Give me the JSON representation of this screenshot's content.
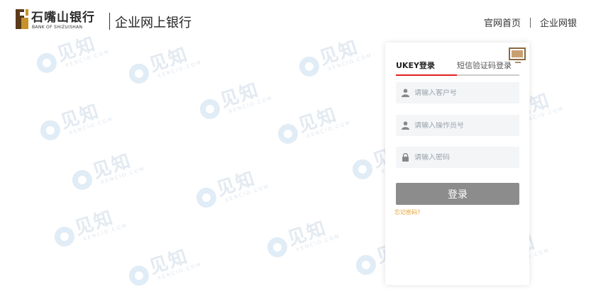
{
  "header": {
    "bank_name_cn": "石嘴山银行",
    "bank_name_en": "BANK OF SHIZUISHAN",
    "site_title": "企业网上银行",
    "nav": [
      "官网首页",
      "企业网银"
    ]
  },
  "login": {
    "tabs": [
      {
        "label": "UKEY登录",
        "active": true
      },
      {
        "label": "短信验证码登录",
        "active": false
      }
    ],
    "customer_no": {
      "placeholder": "请输入客户号",
      "value": ""
    },
    "operator_no": {
      "placeholder": "请输入操作员号",
      "value": ""
    },
    "password": {
      "placeholder": "请输入密码",
      "value": ""
    },
    "submit_label": "登录",
    "forgot_label": "忘记密码?"
  },
  "watermark": {
    "text": "见知",
    "sub": "XENCIO.COM"
  },
  "colors": {
    "accent_red": "#e02020",
    "logo_gold": "#c8922a",
    "logo_brown": "#5a3a1a",
    "button_gray": "#8c8c8c",
    "forgot_orange": "#e0a030"
  }
}
